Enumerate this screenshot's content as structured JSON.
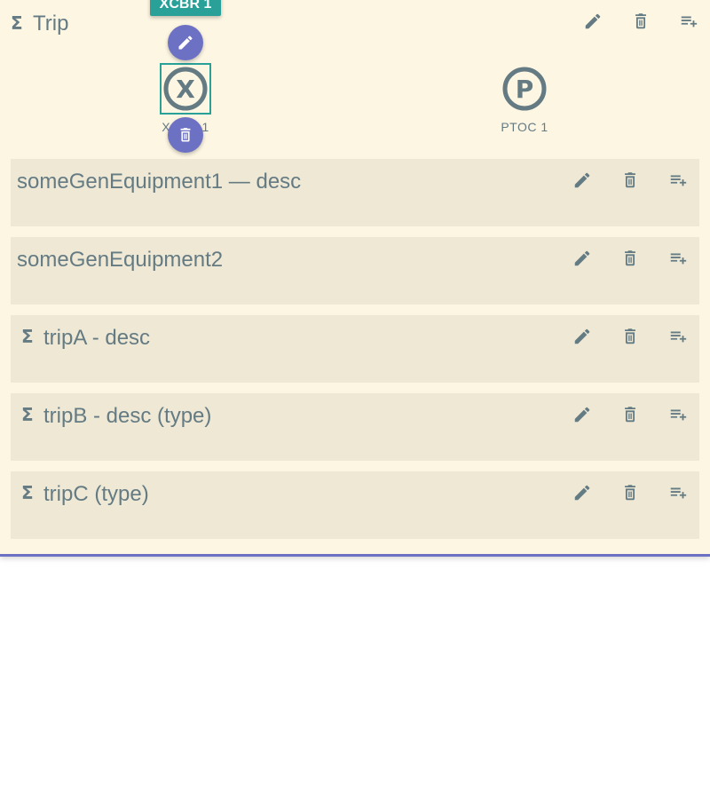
{
  "header": {
    "sigma": "Σ",
    "title": "Trip"
  },
  "tooltip": {
    "label": "XCBR 1"
  },
  "lnodes": [
    {
      "label": "XCBR 1",
      "letter": "X",
      "icon": "xcbr-icon"
    },
    {
      "label": "PTOC 1",
      "letter": "P",
      "icon": "ptoc-icon"
    }
  ],
  "cards": [
    {
      "sigma": "",
      "title": "someGenEquipment1 — desc"
    },
    {
      "sigma": "",
      "title": "someGenEquipment2"
    },
    {
      "sigma": "Σ",
      "title": "tripA - desc"
    },
    {
      "sigma": "Σ",
      "title": "tripB - desc (type)"
    },
    {
      "sigma": "Σ",
      "title": "tripC (type)"
    }
  ],
  "icons": {
    "edit": "edit-icon",
    "delete": "delete-icon",
    "add": "playlist-add-icon"
  },
  "colors": {
    "background": "#fdf6e3",
    "card": "#eee8d5",
    "text": "#657b83",
    "accent": "#6c71c4",
    "selected": "#2aa198"
  }
}
